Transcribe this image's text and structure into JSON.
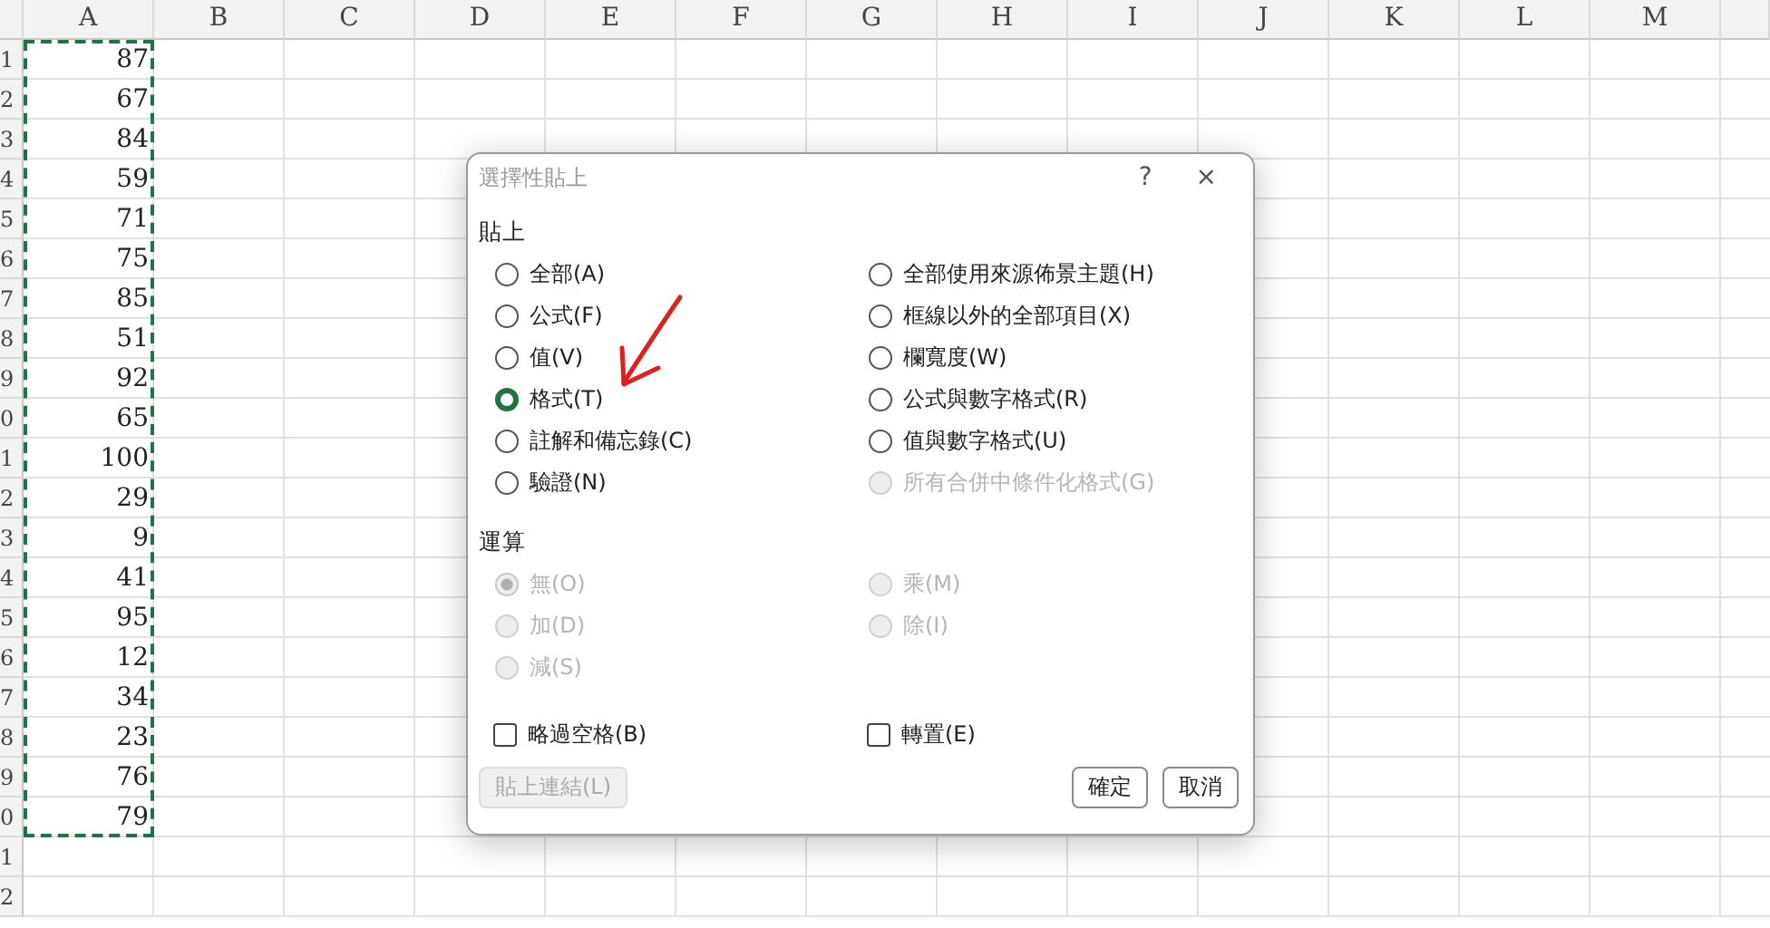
{
  "sheet": {
    "columns": [
      {
        "label": "A",
        "copied": true
      },
      {
        "label": "B"
      },
      {
        "label": "C"
      },
      {
        "label": "D"
      },
      {
        "label": "E"
      },
      {
        "label": "F"
      },
      {
        "label": "G"
      },
      {
        "label": "H"
      },
      {
        "label": "I"
      },
      {
        "label": "J"
      },
      {
        "label": "K"
      },
      {
        "label": "L"
      },
      {
        "label": "M"
      }
    ],
    "rows": [
      {
        "header": "1",
        "cells": [
          "87"
        ]
      },
      {
        "header": "2",
        "cells": [
          "67"
        ]
      },
      {
        "header": "3",
        "cells": [
          "84"
        ]
      },
      {
        "header": "4",
        "cells": [
          "59"
        ]
      },
      {
        "header": "5",
        "cells": [
          "71"
        ]
      },
      {
        "header": "6",
        "cells": [
          "75"
        ]
      },
      {
        "header": "7",
        "cells": [
          "85"
        ]
      },
      {
        "header": "8",
        "cells": [
          "51"
        ]
      },
      {
        "header": "9",
        "cells": [
          "92"
        ]
      },
      {
        "header": "0",
        "cells": [
          "65"
        ]
      },
      {
        "header": "1",
        "cells": [
          "100"
        ]
      },
      {
        "header": "2",
        "cells": [
          "29"
        ]
      },
      {
        "header": "3",
        "cells": [
          "9"
        ]
      },
      {
        "header": "4",
        "cells": [
          "41"
        ]
      },
      {
        "header": "5",
        "cells": [
          "95"
        ]
      },
      {
        "header": "6",
        "cells": [
          "12"
        ]
      },
      {
        "header": "7",
        "cells": [
          "34"
        ]
      },
      {
        "header": "8",
        "cells": [
          "23"
        ]
      },
      {
        "header": "9",
        "cells": [
          "76"
        ]
      },
      {
        "header": "0",
        "cells": [
          "79"
        ]
      },
      {
        "header": "1",
        "cells": []
      },
      {
        "header": "2",
        "cells": []
      }
    ]
  },
  "dialog": {
    "title": "選擇性貼上",
    "help": "?",
    "close": "×",
    "paste": {
      "heading": "貼上",
      "left": [
        {
          "label": "全部(A)",
          "selected": false,
          "disabled": false
        },
        {
          "label": "公式(F)",
          "selected": false,
          "disabled": false
        },
        {
          "label": "值(V)",
          "selected": false,
          "disabled": false
        },
        {
          "label": "格式(T)",
          "selected": true,
          "disabled": false
        },
        {
          "label": "註解和備忘錄(C)",
          "selected": false,
          "disabled": false
        },
        {
          "label": "驗證(N)",
          "selected": false,
          "disabled": false
        }
      ],
      "right": [
        {
          "label": "全部使用來源佈景主題(H)",
          "selected": false,
          "disabled": false
        },
        {
          "label": "框線以外的全部項目(X)",
          "selected": false,
          "disabled": false
        },
        {
          "label": "欄寬度(W)",
          "selected": false,
          "disabled": false
        },
        {
          "label": "公式與數字格式(R)",
          "selected": false,
          "disabled": false
        },
        {
          "label": "值與數字格式(U)",
          "selected": false,
          "disabled": false
        },
        {
          "label": "所有合併中條件化格式(G)",
          "selected": false,
          "disabled": true
        }
      ]
    },
    "operation": {
      "heading": "運算",
      "left": [
        {
          "label": "無(O)",
          "selected": true,
          "disabled": true
        },
        {
          "label": "加(D)",
          "selected": false,
          "disabled": true
        },
        {
          "label": "減(S)",
          "selected": false,
          "disabled": true
        }
      ],
      "right": [
        {
          "label": "乘(M)",
          "selected": false,
          "disabled": true
        },
        {
          "label": "除(I)",
          "selected": false,
          "disabled": true
        }
      ]
    },
    "checkboxes": [
      {
        "label": "略過空格(B)",
        "checked": false
      },
      {
        "label": "轉置(E)",
        "checked": false
      }
    ],
    "buttons": [
      {
        "label": "貼上連結(L)",
        "disabled": true
      },
      {
        "label": "確定",
        "disabled": false
      },
      {
        "label": "取消",
        "disabled": false
      }
    ]
  }
}
